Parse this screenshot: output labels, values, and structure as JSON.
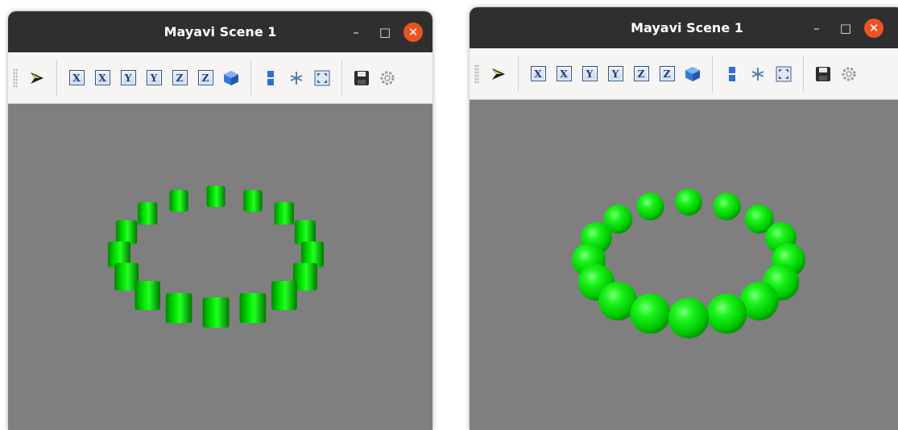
{
  "windows": [
    {
      "title": "Mayavi Scene 1",
      "scene": {
        "glyph_shape": "cylinder",
        "glyph_color": "#00cc00",
        "background_color": "#7f7f7f",
        "glyph_count": 16
      }
    },
    {
      "title": "Mayavi Scene 1",
      "scene": {
        "glyph_shape": "sphere",
        "glyph_color": "#00cc00",
        "background_color": "#7f7f7f",
        "glyph_count": 16
      }
    }
  ],
  "window_buttons": {
    "minimize": "–",
    "maximize": "□",
    "close": "✕"
  },
  "toolbar": {
    "axis_buttons": [
      "X",
      "X",
      "Y",
      "Y",
      "Z",
      "Z"
    ],
    "icons": [
      "mayavi-logo-icon",
      "view-x-minus-icon",
      "view-x-plus-icon",
      "view-y-minus-icon",
      "view-y-plus-icon",
      "view-z-minus-icon",
      "view-z-plus-icon",
      "isometric-view-icon",
      "parallel-projection-icon",
      "axes-indicator-icon",
      "fullscreen-icon",
      "save-icon",
      "configure-icon"
    ]
  }
}
